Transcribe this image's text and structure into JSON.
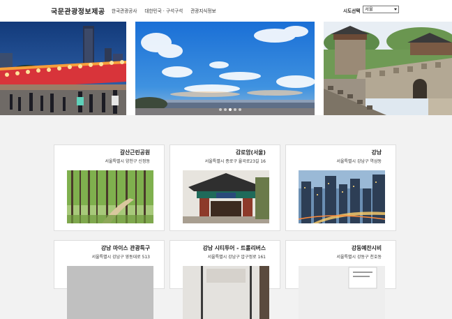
{
  "header": {
    "logo": "국문관광정보제공",
    "nav": [
      "한국관광공사",
      "대한민국 · 구석구석",
      "관광지식정보"
    ],
    "region_label": "시도선택",
    "region_value": "서울"
  },
  "hero": {
    "slides": [
      "night-market-photo",
      "seaside-sky-photo",
      "fortress-wall-photo"
    ],
    "active_dot": 3,
    "dot_count": 5
  },
  "cards": [
    {
      "title": "갈산근린공원",
      "address": "서울특별시 양천구 신정동",
      "image": "forest-photo"
    },
    {
      "title": "감로암(서울)",
      "address": "서울특별시 종로구 율곡로23길 16",
      "image": "temple-gate-photo"
    },
    {
      "title": "강남",
      "address": "서울특별시 강남구 역삼동",
      "image": "city-skyline-photo"
    },
    {
      "title": "강남 마이스 관광특구",
      "address": "서울특별시 강남구 영동대로 513",
      "image": "building-photo"
    },
    {
      "title": "강남 시티투어 - 트롤리버스",
      "address": "서울특별시 강남구 압구정로 161",
      "image": "street-photo"
    },
    {
      "title": "강동예찬시비",
      "address": "서울특별시 강동구 천호동",
      "image": "monument-photo"
    }
  ]
}
